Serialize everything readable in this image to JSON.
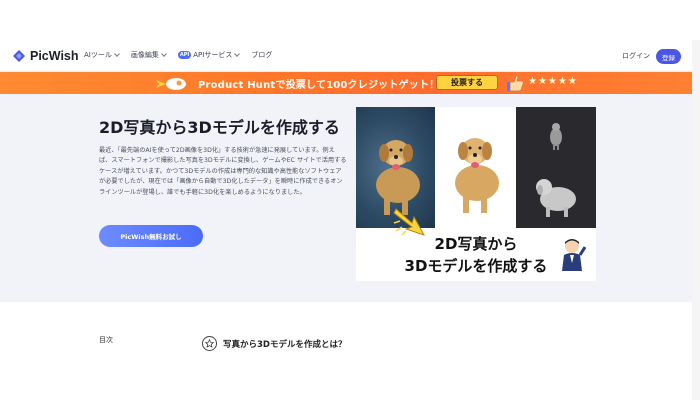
{
  "brand": {
    "name": "PicWish",
    "primary_color": "#4b56e6"
  },
  "nav": {
    "menu": [
      {
        "label": "AIツール",
        "has_dropdown": true
      },
      {
        "label": "画像編集",
        "has_dropdown": true
      },
      {
        "label": "APIサービス",
        "has_dropdown": true,
        "badge": "API"
      },
      {
        "label": "ブログ",
        "has_dropdown": false
      }
    ],
    "login": "ログイン",
    "register": "登録"
  },
  "promo": {
    "text": "Product Huntで投票して100クレジットゲット！",
    "button": "投票する",
    "stars": "★★★★★",
    "background": "#ff7a2a"
  },
  "hero": {
    "title": "2D写真から3Dモデルを作成する",
    "description": "最近、「最先端のAIを使って2D画像を3D化」する技術が急速に発展しています。例えば、スマートフォンで撮影した写真を3Dモデルに変換し、ゲームやEC サイトで活用するケースが増えています。かつて3Dモデルの作成は専門的な知識や高性能なソフトウェアが必要でしたが、現在では「画像から自動で3D化したデータ」を瞬時に作成できるオンラインツールが登場し、誰でも手軽に3D化を楽しめるようになりました。",
    "cta": "PicWish無料お試し",
    "image_caption_line1": "2D写真から",
    "image_caption_line2": "3Dモデルを作成する"
  },
  "toc": {
    "label": "目次",
    "items": [
      {
        "text": "写真から3Dモデルを作成とは？",
        "icon": "star-icon"
      }
    ]
  }
}
